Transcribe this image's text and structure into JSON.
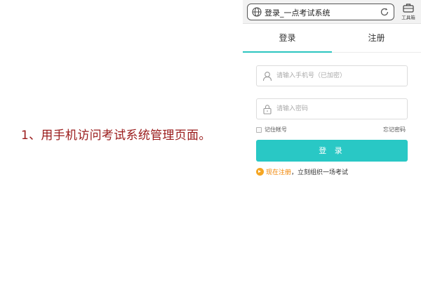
{
  "caption": "1、用手机访问考试系统管理页面。",
  "browser": {
    "url_title": "登录_一点考试系统",
    "toolbox_label": "工具箱"
  },
  "tabs": {
    "login": "登录",
    "register": "注册",
    "active": "login"
  },
  "form": {
    "phone_placeholder": "请输入手机号（已加密）",
    "password_placeholder": "请输入密码",
    "remember_label": "记住帐号",
    "forgot_label": "忘记密码",
    "submit_label": "登 录"
  },
  "register_prompt": {
    "link": "现在注册",
    "rest": "，立刻组织一场考试"
  },
  "colors": {
    "accent": "#29c8c5",
    "caption": "#9a1b1b",
    "link": "#f08300"
  },
  "icons": {
    "url": "globe-icon",
    "reload": "reload-icon",
    "toolbox": "toolbox-icon",
    "phone": "user-icon",
    "password": "lock-icon",
    "register": "arrow-right-circle-icon"
  }
}
